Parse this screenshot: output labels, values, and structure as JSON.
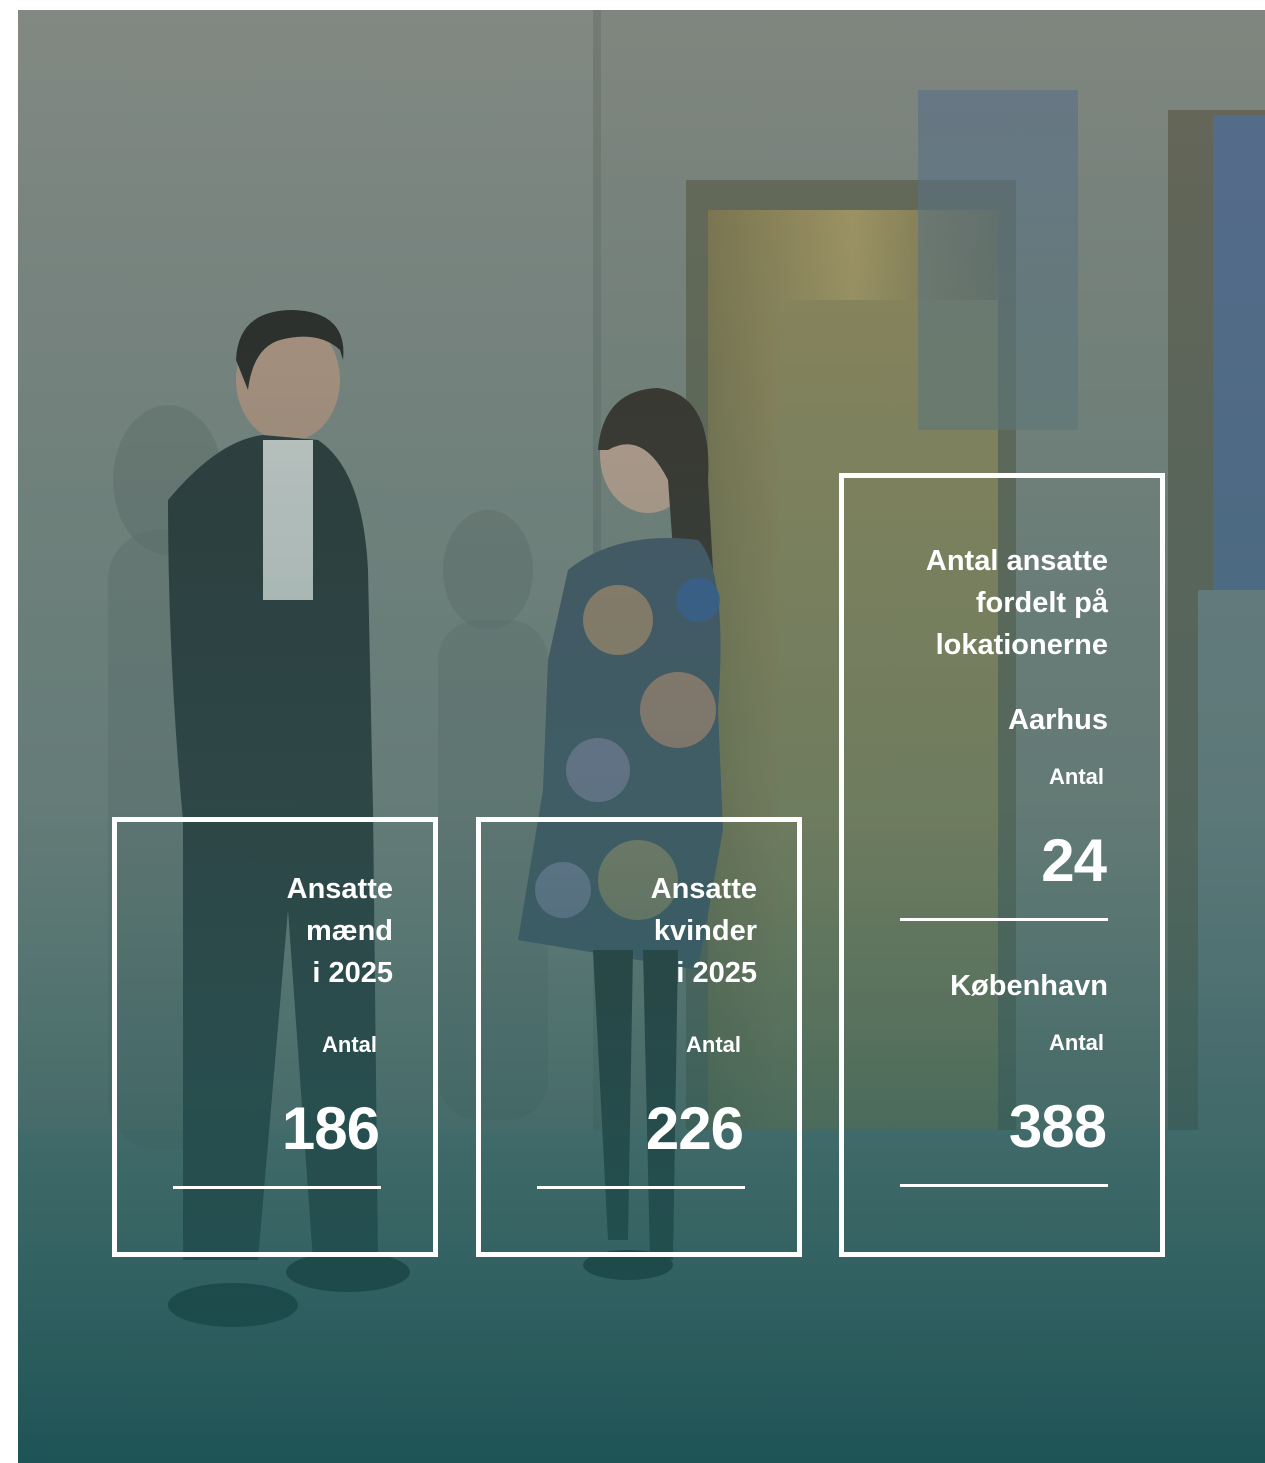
{
  "stats": [
    {
      "title": "Ansatte\nmænd\ni 2025",
      "sub": "Antal",
      "value": "186"
    },
    {
      "title": "Ansatte\nkvinder\ni 2025",
      "sub": "Antal",
      "value": "226"
    }
  ],
  "locations": {
    "title": "Antal ansatte\nfordelt på\nlokationerne",
    "items": [
      {
        "name": "Aarhus",
        "sub": "Antal",
        "value": "24"
      },
      {
        "name": "København",
        "sub": "Antal",
        "value": "388"
      }
    ]
  }
}
